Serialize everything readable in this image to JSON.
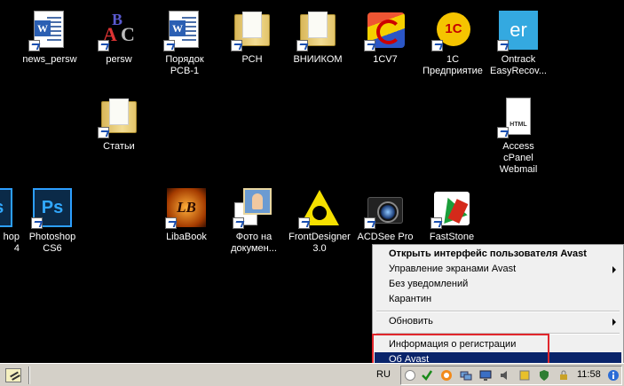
{
  "desktop": {
    "icons": [
      {
        "label": "news_persw"
      },
      {
        "label": "persw"
      },
      {
        "label": "Порядок\nРСВ-1"
      },
      {
        "label": "РСН"
      },
      {
        "label": "ВНИИКОМ"
      },
      {
        "label": "1CV7"
      },
      {
        "label": "1С\nПредприятие"
      },
      {
        "label": "Ontrack\nEasyRecov..."
      },
      {
        "label": "Статьи"
      },
      {
        "label": "Access cPanel\nWebmail"
      },
      {
        "label": "hop\n4"
      },
      {
        "label": "Photoshop\nCS6"
      },
      {
        "label": "LibaBook"
      },
      {
        "label": "Фото на\nдокумен..."
      },
      {
        "label": "FrontDesigner\n3.0"
      },
      {
        "label": "ACDSee Pro 7"
      },
      {
        "label": "FastStone"
      }
    ],
    "icon_glyphs": {
      "word": "W",
      "photoshop": "Ps",
      "easyrecovery": "er",
      "one_c": "1С",
      "libabook": "LB",
      "html": "HTML",
      "abc_a": "A",
      "abc_b": "B",
      "abc_c": "C"
    }
  },
  "context_menu": {
    "items": [
      {
        "label": "Открыть интерфейс пользователя Avast",
        "bold": true
      },
      {
        "label": "Управление экранами Avast",
        "submenu": true
      },
      {
        "label": "Без уведомлений"
      },
      {
        "label": "Карантин"
      },
      {
        "label": "Обновить",
        "submenu": true
      },
      {
        "label": "Информация о регистрации"
      },
      {
        "label": "Об Avast",
        "selected": true
      }
    ],
    "highlight_color": "#e0262c",
    "selected_color": "#0a246a"
  },
  "taskbar": {
    "language": "RU",
    "clock": "11:58",
    "tray_icons": [
      "chevron-icon",
      "checkmark-icon",
      "avast-icon",
      "network-icon",
      "monitor-icon",
      "volume-icon",
      "flag-icon",
      "shield-icon",
      "lock-icon",
      "info-icon"
    ]
  }
}
